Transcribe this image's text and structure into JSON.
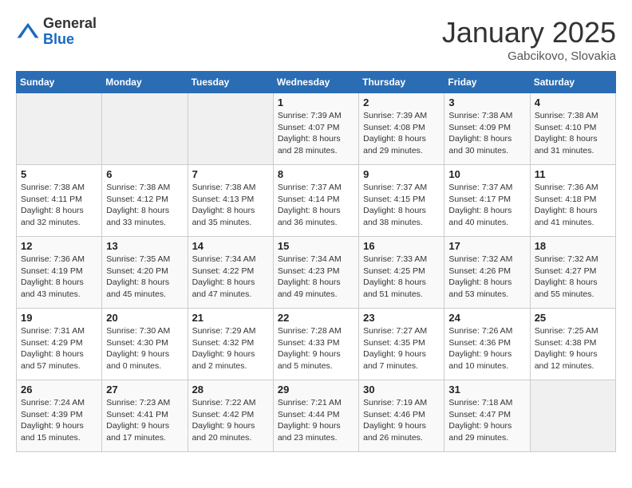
{
  "header": {
    "logo_general": "General",
    "logo_blue": "Blue",
    "month": "January 2025",
    "location": "Gabcikovo, Slovakia"
  },
  "weekdays": [
    "Sunday",
    "Monday",
    "Tuesday",
    "Wednesday",
    "Thursday",
    "Friday",
    "Saturday"
  ],
  "weeks": [
    [
      {
        "day": "",
        "info": ""
      },
      {
        "day": "",
        "info": ""
      },
      {
        "day": "",
        "info": ""
      },
      {
        "day": "1",
        "info": "Sunrise: 7:39 AM\nSunset: 4:07 PM\nDaylight: 8 hours and 28 minutes."
      },
      {
        "day": "2",
        "info": "Sunrise: 7:39 AM\nSunset: 4:08 PM\nDaylight: 8 hours and 29 minutes."
      },
      {
        "day": "3",
        "info": "Sunrise: 7:38 AM\nSunset: 4:09 PM\nDaylight: 8 hours and 30 minutes."
      },
      {
        "day": "4",
        "info": "Sunrise: 7:38 AM\nSunset: 4:10 PM\nDaylight: 8 hours and 31 minutes."
      }
    ],
    [
      {
        "day": "5",
        "info": "Sunrise: 7:38 AM\nSunset: 4:11 PM\nDaylight: 8 hours and 32 minutes."
      },
      {
        "day": "6",
        "info": "Sunrise: 7:38 AM\nSunset: 4:12 PM\nDaylight: 8 hours and 33 minutes."
      },
      {
        "day": "7",
        "info": "Sunrise: 7:38 AM\nSunset: 4:13 PM\nDaylight: 8 hours and 35 minutes."
      },
      {
        "day": "8",
        "info": "Sunrise: 7:37 AM\nSunset: 4:14 PM\nDaylight: 8 hours and 36 minutes."
      },
      {
        "day": "9",
        "info": "Sunrise: 7:37 AM\nSunset: 4:15 PM\nDaylight: 8 hours and 38 minutes."
      },
      {
        "day": "10",
        "info": "Sunrise: 7:37 AM\nSunset: 4:17 PM\nDaylight: 8 hours and 40 minutes."
      },
      {
        "day": "11",
        "info": "Sunrise: 7:36 AM\nSunset: 4:18 PM\nDaylight: 8 hours and 41 minutes."
      }
    ],
    [
      {
        "day": "12",
        "info": "Sunrise: 7:36 AM\nSunset: 4:19 PM\nDaylight: 8 hours and 43 minutes."
      },
      {
        "day": "13",
        "info": "Sunrise: 7:35 AM\nSunset: 4:20 PM\nDaylight: 8 hours and 45 minutes."
      },
      {
        "day": "14",
        "info": "Sunrise: 7:34 AM\nSunset: 4:22 PM\nDaylight: 8 hours and 47 minutes."
      },
      {
        "day": "15",
        "info": "Sunrise: 7:34 AM\nSunset: 4:23 PM\nDaylight: 8 hours and 49 minutes."
      },
      {
        "day": "16",
        "info": "Sunrise: 7:33 AM\nSunset: 4:25 PM\nDaylight: 8 hours and 51 minutes."
      },
      {
        "day": "17",
        "info": "Sunrise: 7:32 AM\nSunset: 4:26 PM\nDaylight: 8 hours and 53 minutes."
      },
      {
        "day": "18",
        "info": "Sunrise: 7:32 AM\nSunset: 4:27 PM\nDaylight: 8 hours and 55 minutes."
      }
    ],
    [
      {
        "day": "19",
        "info": "Sunrise: 7:31 AM\nSunset: 4:29 PM\nDaylight: 8 hours and 57 minutes."
      },
      {
        "day": "20",
        "info": "Sunrise: 7:30 AM\nSunset: 4:30 PM\nDaylight: 9 hours and 0 minutes."
      },
      {
        "day": "21",
        "info": "Sunrise: 7:29 AM\nSunset: 4:32 PM\nDaylight: 9 hours and 2 minutes."
      },
      {
        "day": "22",
        "info": "Sunrise: 7:28 AM\nSunset: 4:33 PM\nDaylight: 9 hours and 5 minutes."
      },
      {
        "day": "23",
        "info": "Sunrise: 7:27 AM\nSunset: 4:35 PM\nDaylight: 9 hours and 7 minutes."
      },
      {
        "day": "24",
        "info": "Sunrise: 7:26 AM\nSunset: 4:36 PM\nDaylight: 9 hours and 10 minutes."
      },
      {
        "day": "25",
        "info": "Sunrise: 7:25 AM\nSunset: 4:38 PM\nDaylight: 9 hours and 12 minutes."
      }
    ],
    [
      {
        "day": "26",
        "info": "Sunrise: 7:24 AM\nSunset: 4:39 PM\nDaylight: 9 hours and 15 minutes."
      },
      {
        "day": "27",
        "info": "Sunrise: 7:23 AM\nSunset: 4:41 PM\nDaylight: 9 hours and 17 minutes."
      },
      {
        "day": "28",
        "info": "Sunrise: 7:22 AM\nSunset: 4:42 PM\nDaylight: 9 hours and 20 minutes."
      },
      {
        "day": "29",
        "info": "Sunrise: 7:21 AM\nSunset: 4:44 PM\nDaylight: 9 hours and 23 minutes."
      },
      {
        "day": "30",
        "info": "Sunrise: 7:19 AM\nSunset: 4:46 PM\nDaylight: 9 hours and 26 minutes."
      },
      {
        "day": "31",
        "info": "Sunrise: 7:18 AM\nSunset: 4:47 PM\nDaylight: 9 hours and 29 minutes."
      },
      {
        "day": "",
        "info": ""
      }
    ]
  ]
}
